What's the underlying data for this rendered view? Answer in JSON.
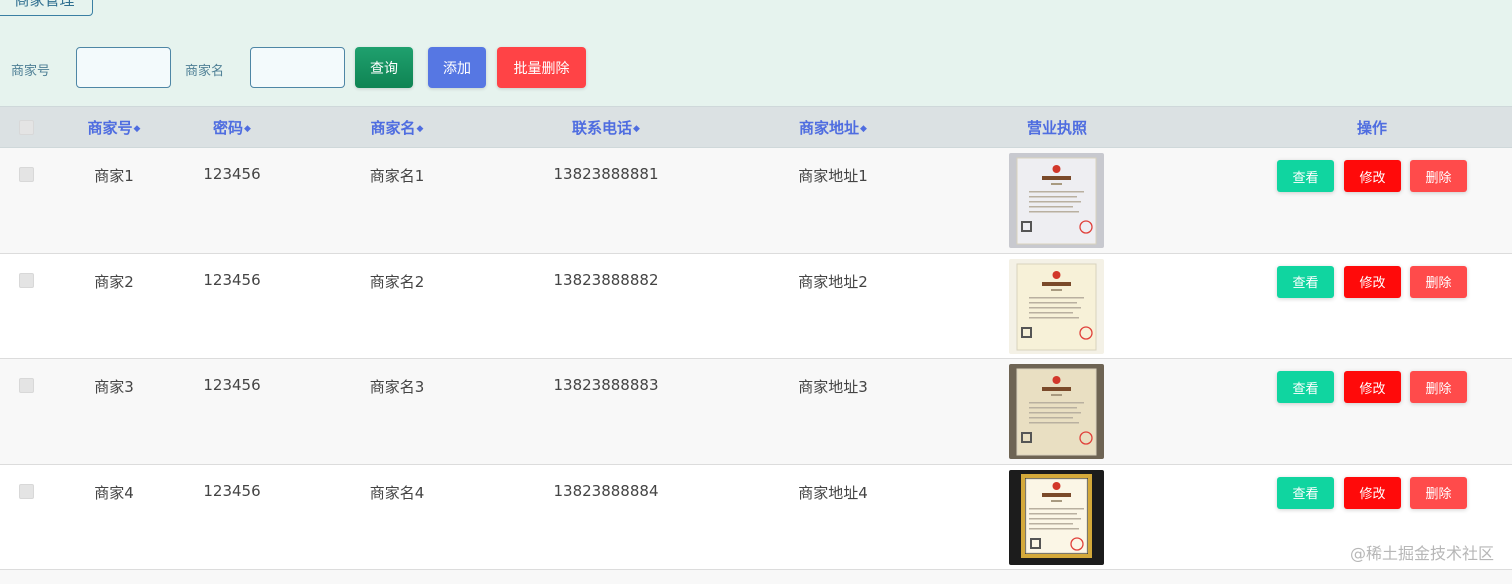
{
  "page_title": "商家管理",
  "search": {
    "merchant_no_label": "商家号",
    "merchant_no_value": "",
    "merchant_name_label": "商家名",
    "merchant_name_value": "",
    "query_button": "查询",
    "add_button": "添加",
    "batch_delete_button": "批量删除"
  },
  "table": {
    "headers": {
      "merchant_no": "商家号",
      "password": "密码",
      "merchant_name": "商家名",
      "phone": "联系电话",
      "address": "商家地址",
      "license": "营业执照",
      "actions": "操作"
    },
    "rows": [
      {
        "merchant_no": "商家1",
        "password": "123456",
        "merchant_name": "商家名1",
        "phone": "13823888881",
        "address": "商家地址1",
        "license_image": "business-license-photo"
      },
      {
        "merchant_no": "商家2",
        "password": "123456",
        "merchant_name": "商家名2",
        "phone": "13823888882",
        "address": "商家地址2",
        "license_image": "business-license-photo"
      },
      {
        "merchant_no": "商家3",
        "password": "123456",
        "merchant_name": "商家名3",
        "phone": "13823888883",
        "address": "商家地址3",
        "license_image": "business-license-photo"
      },
      {
        "merchant_no": "商家4",
        "password": "123456",
        "merchant_name": "商家名4",
        "phone": "13823888884",
        "address": "商家地址4",
        "license_image": "business-license-photo"
      }
    ],
    "row_actions": {
      "view": "查看",
      "edit": "修改",
      "delete": "删除"
    }
  },
  "watermark": "@稀土掘金技术社区",
  "colors": {
    "page_background": "#e6f3ee",
    "header_text": "#4f6de0",
    "query": "#0f8453",
    "add": "#5677e3",
    "batch_delete": "#ff4346",
    "view": "#10d5a0",
    "edit": "#ff0a0a",
    "delete": "#ff4b4b"
  }
}
